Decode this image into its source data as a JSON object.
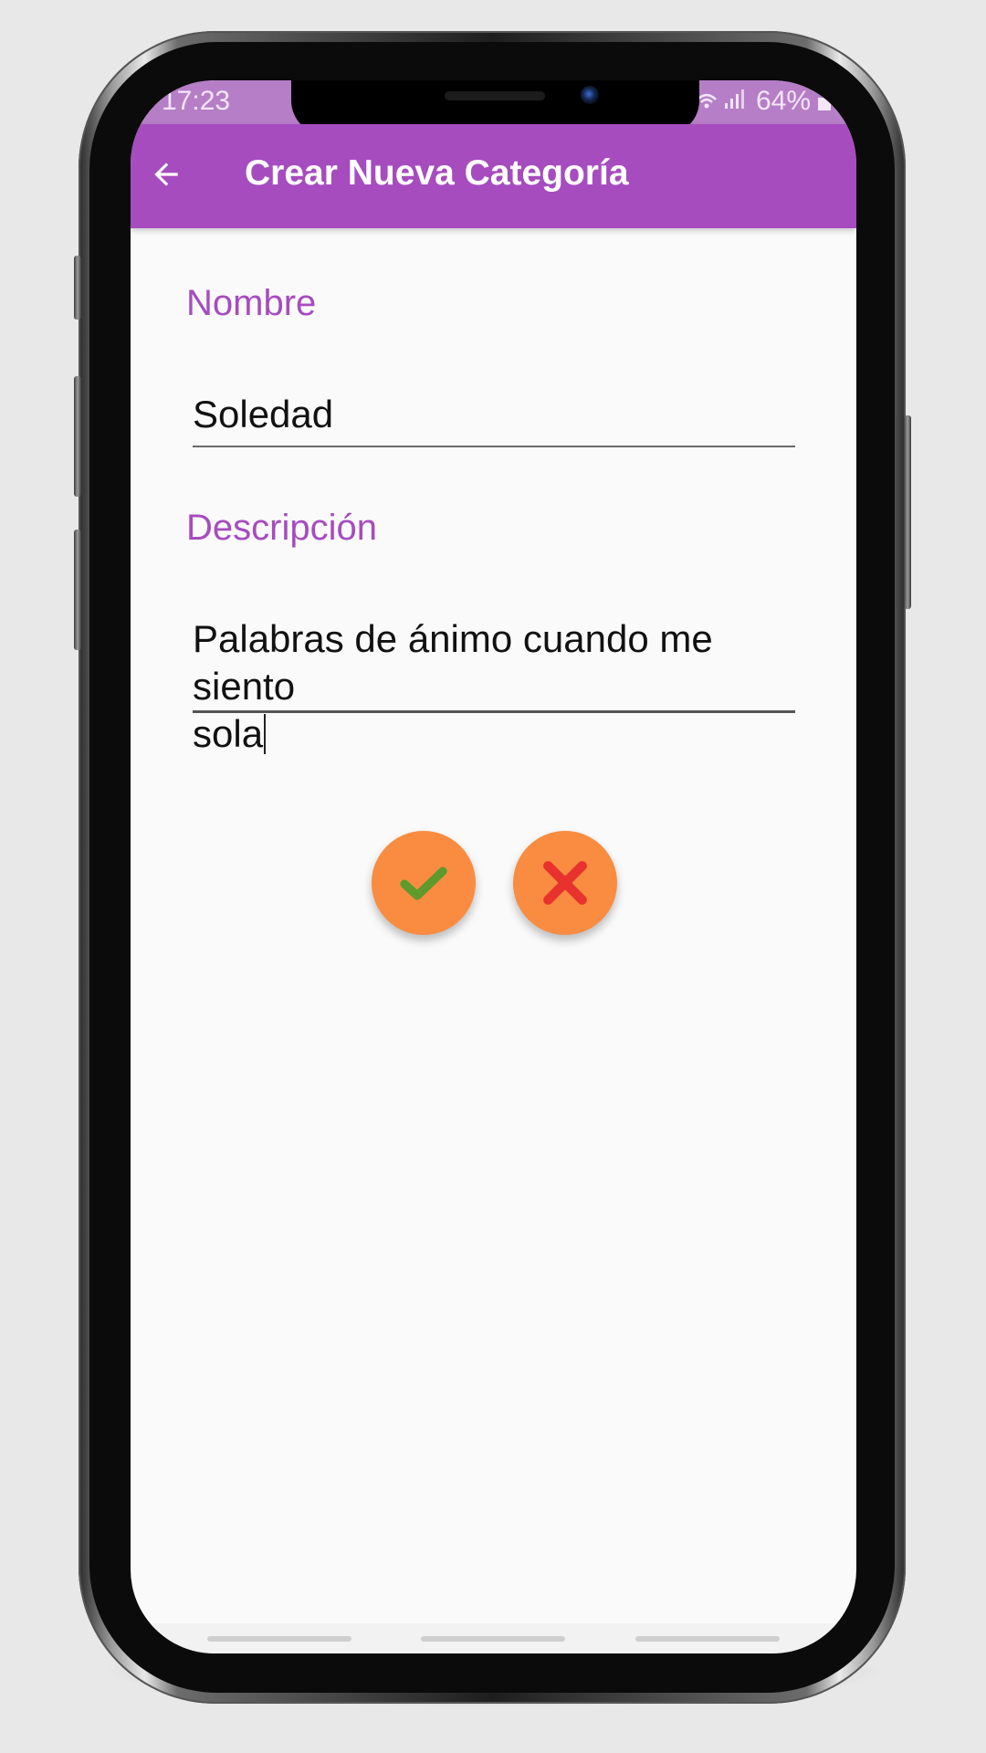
{
  "status_bar": {
    "time": "17:23",
    "battery": "64%",
    "icons": "wifi-signal-icons"
  },
  "app_bar": {
    "title": "Crear Nueva Categoría",
    "back_icon": "arrow-back-icon"
  },
  "form": {
    "name_label": "Nombre",
    "name_value": "Soledad",
    "description_label": "Descripción",
    "description_value_line1": "Palabras de ánimo cuando me siento",
    "description_value_line2": "sola"
  },
  "actions": {
    "confirm_icon": "check-icon",
    "cancel_icon": "close-icon"
  },
  "colors": {
    "primary": "#a64cbf",
    "status_bar": "#b57ec7",
    "accent": "#f98c40",
    "check": "#5e9a2d",
    "cross": "#e8322e"
  }
}
